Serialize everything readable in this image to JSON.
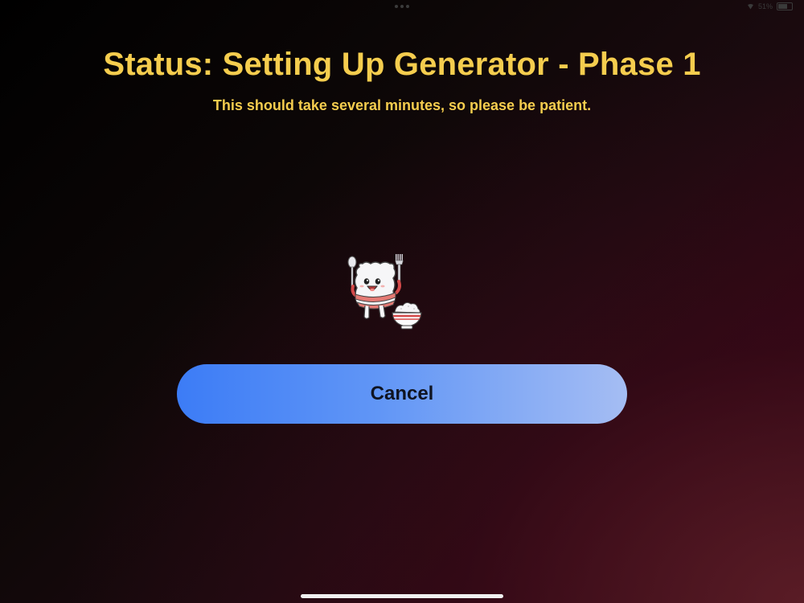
{
  "status_bar": {
    "battery_text": "51%",
    "icons": [
      "wifi-icon",
      "battery-icon"
    ]
  },
  "header": {
    "title": "Status: Setting Up Generator - Phase 1",
    "subtitle": "This should take several minutes, so please be patient."
  },
  "illustration": {
    "name": "rice-mascot-illustration"
  },
  "actions": {
    "cancel_label": "Cancel"
  },
  "colors": {
    "title": "#f5cd4e",
    "button_gradient_start": "#3c7cf6",
    "button_gradient_end": "#a5bdf3",
    "button_text": "#0f1422"
  }
}
